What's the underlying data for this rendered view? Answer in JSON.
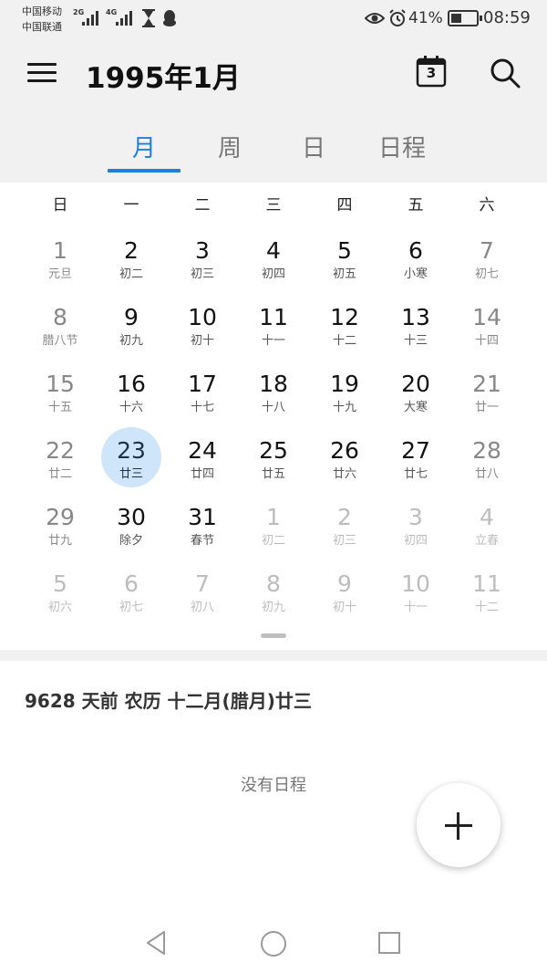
{
  "statusbar": {
    "carrier1": "中国移动",
    "carrier2": "中国联通",
    "sig1": "2G",
    "sig2": "4G",
    "battery_pct": "41%",
    "battery_level": 0.41,
    "time": "08:59",
    "icons": [
      "hourglass-icon",
      "qq-icon",
      "eye-icon",
      "alarm-icon",
      "battery-icon"
    ]
  },
  "header": {
    "title": "1995年1月",
    "today_num": "3",
    "icons": [
      "menu-icon",
      "today-calendar-icon",
      "search-icon"
    ]
  },
  "tabs": [
    {
      "label": "月",
      "active": true
    },
    {
      "label": "周",
      "active": false
    },
    {
      "label": "日",
      "active": false
    },
    {
      "label": "日程",
      "active": false
    }
  ],
  "colors": {
    "accent": "#1f7fd8",
    "selected_bg": "#cfe5fa"
  },
  "weekdays": [
    "日",
    "一",
    "二",
    "三",
    "四",
    "五",
    "六"
  ],
  "days": [
    [
      {
        "num": "1",
        "lunar": "元旦"
      },
      {
        "num": "2",
        "lunar": "初二"
      },
      {
        "num": "3",
        "lunar": "初三"
      },
      {
        "num": "4",
        "lunar": "初四"
      },
      {
        "num": "5",
        "lunar": "初五"
      },
      {
        "num": "6",
        "lunar": "小寒"
      },
      {
        "num": "7",
        "lunar": "初七"
      }
    ],
    [
      {
        "num": "8",
        "lunar": "腊八节"
      },
      {
        "num": "9",
        "lunar": "初九"
      },
      {
        "num": "10",
        "lunar": "初十"
      },
      {
        "num": "11",
        "lunar": "十一"
      },
      {
        "num": "12",
        "lunar": "十二"
      },
      {
        "num": "13",
        "lunar": "十三"
      },
      {
        "num": "14",
        "lunar": "十四"
      }
    ],
    [
      {
        "num": "15",
        "lunar": "十五"
      },
      {
        "num": "16",
        "lunar": "十六"
      },
      {
        "num": "17",
        "lunar": "十七"
      },
      {
        "num": "18",
        "lunar": "十八"
      },
      {
        "num": "19",
        "lunar": "十九"
      },
      {
        "num": "20",
        "lunar": "大寒"
      },
      {
        "num": "21",
        "lunar": "廿一"
      }
    ],
    [
      {
        "num": "22",
        "lunar": "廿二"
      },
      {
        "num": "23",
        "lunar": "廿三",
        "selected": true
      },
      {
        "num": "24",
        "lunar": "廿四"
      },
      {
        "num": "25",
        "lunar": "廿五"
      },
      {
        "num": "26",
        "lunar": "廿六"
      },
      {
        "num": "27",
        "lunar": "廿七"
      },
      {
        "num": "28",
        "lunar": "廿八"
      }
    ],
    [
      {
        "num": "29",
        "lunar": "廿九"
      },
      {
        "num": "30",
        "lunar": "除夕"
      },
      {
        "num": "31",
        "lunar": "春节"
      },
      {
        "num": "1",
        "lunar": "初二",
        "other": true
      },
      {
        "num": "2",
        "lunar": "初三",
        "other": true
      },
      {
        "num": "3",
        "lunar": "初四",
        "other": true
      },
      {
        "num": "4",
        "lunar": "立春",
        "other": true
      }
    ],
    [
      {
        "num": "5",
        "lunar": "初六",
        "other": true
      },
      {
        "num": "6",
        "lunar": "初七",
        "other": true
      },
      {
        "num": "7",
        "lunar": "初八",
        "other": true
      },
      {
        "num": "8",
        "lunar": "初九",
        "other": true
      },
      {
        "num": "9",
        "lunar": "初十",
        "other": true
      },
      {
        "num": "10",
        "lunar": "十一",
        "other": true
      },
      {
        "num": "11",
        "lunar": "十二",
        "other": true
      }
    ]
  ],
  "info": {
    "text": "9628 天前  农历 十二月(腊月)廿三",
    "empty": "没有日程"
  },
  "navbar": {
    "icons": [
      "back-icon",
      "home-icon",
      "recents-icon"
    ]
  }
}
